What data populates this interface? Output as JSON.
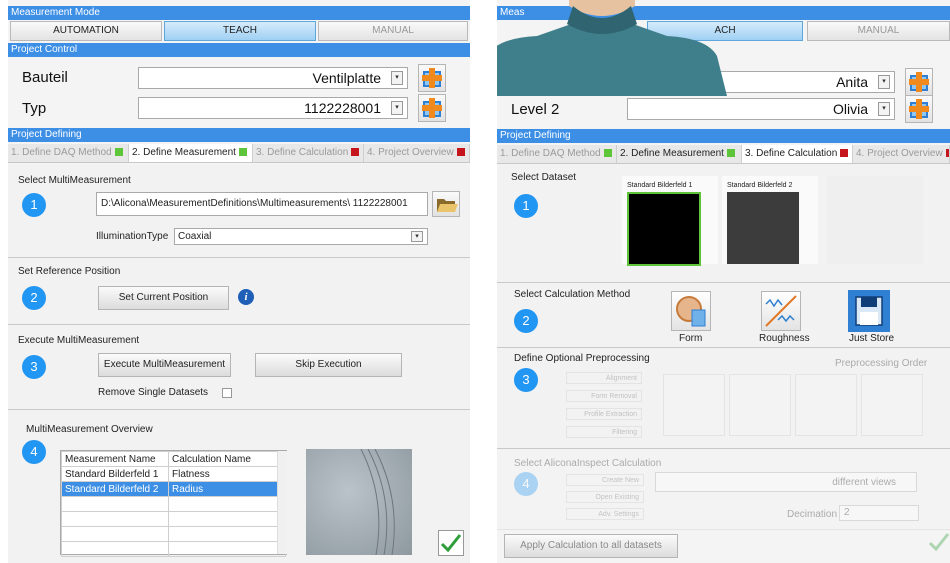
{
  "left": {
    "mode_header": "Measurement Mode",
    "modes": [
      "AUTOMATION",
      "TEACH",
      "MANUAL"
    ],
    "project_control_header": "Project Control",
    "fields": [
      {
        "label": "Bauteil",
        "value": "Ventilplatte"
      },
      {
        "label": "Typ",
        "value": "1122228001"
      }
    ],
    "project_defining_header": "Project Defining",
    "tabs": [
      "1. Define DAQ Method",
      "2. Define Measurement",
      "3. Define Calculation",
      "4. Project Overview"
    ],
    "select_multimeasurement": {
      "title": "Select MultiMeasurement",
      "step": "1",
      "path": "D:\\Alicona\\MeasurementDefinitions\\Multimeasurements\\ 1122228001",
      "illumination_label": "IlluminationType",
      "illumination_value": "Coaxial"
    },
    "reference": {
      "title": "Set Reference Position",
      "step": "2",
      "button": "Set Current Position"
    },
    "execute": {
      "title": "Execute MultiMeasurement",
      "step": "3",
      "execute_button": "Execute MultiMeasurement",
      "skip_button": "Skip Execution",
      "remove_label": "Remove Single Datasets"
    },
    "overview": {
      "title": "MultiMeasurement Overview",
      "step": "4",
      "columns": [
        "Measurement Name",
        "Calculation Name"
      ],
      "rows": [
        [
          "Standard Bilderfeld 1",
          "Flatness"
        ],
        [
          "Standard Bilderfeld 2",
          "Radius"
        ]
      ]
    }
  },
  "right": {
    "mode_header": "Meas",
    "modes": [
      "TEACH",
      "MANUAL"
    ],
    "teach_partial": "ACH",
    "fields": [
      {
        "label": "",
        "value": "Anita"
      },
      {
        "label": "Level 2",
        "value": "Olivia"
      }
    ],
    "project_defining_header": "Project Defining",
    "tabs": [
      "1. Define DAQ Method",
      "2. Define Measurement",
      "3. Define Calculation",
      "4. Project Overview"
    ],
    "dataset": {
      "title": "Select Dataset",
      "step": "1",
      "items": [
        "Standard Bilderfeld 1",
        "Standard Bilderfeld 2"
      ]
    },
    "calc_method": {
      "title": "Select Calculation Method",
      "step": "2",
      "options": [
        "Form",
        "Roughness",
        "Just Store"
      ]
    },
    "preprocessing": {
      "title": "Define Optional Preprocessing",
      "step": "3",
      "order_label": "Preprocessing Order",
      "buttons": [
        "Alignment",
        "Form Removal",
        "Profile Extraction",
        "Filtering"
      ]
    },
    "inspect": {
      "title": "Select AliconaInspect Calculation",
      "step": "4",
      "buttons": [
        "Create New",
        "Open Existing",
        "Adv. Settings"
      ],
      "views": "different views",
      "decimation_label": "Decimation",
      "decimation_value": "2"
    },
    "apply_button": "Apply Calculation to all datasets"
  },
  "colors": {
    "accent": "#3d8fe6",
    "step_circle": "#2196f3",
    "status_green": "#5ec43a",
    "status_red": "#c4161c",
    "avatar_shirt": "#3f7f8c"
  }
}
